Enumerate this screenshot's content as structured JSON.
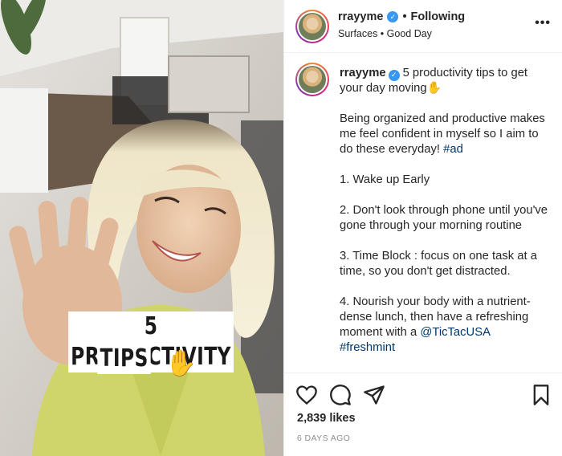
{
  "post": {
    "media_caption": {
      "line1": "5 PRODUCTIVITY",
      "line2": "TIPS",
      "emoji": "✋"
    }
  },
  "header": {
    "username": "rrayyme",
    "separator": "•",
    "follow_status": "Following",
    "location": "Surfaces • Good Day",
    "more_icon": "more-icon"
  },
  "caption": {
    "username": "rrayyme",
    "title": "5 productivity tips to get your day moving✋",
    "intro_text": "Being organized and productive makes me feel confident in myself so I aim to do these everyday! ",
    "intro_tag": "#ad",
    "tip1": "1. Wake up Early",
    "tip2": "2. Don't look through phone until you've gone through your morning routine",
    "tip3": "3. Time Block : focus on one task at a time, so you don't get distracted.",
    "tip4_text": "4. Nourish your body with a nutrient-dense lunch, then have a refreshing moment with a ",
    "tip4_mention": "@TicTacUSA",
    "tip4_tag": "#freshmint"
  },
  "actions": {
    "like_icon": "heart-icon",
    "comment_icon": "comment-icon",
    "share_icon": "paper-plane-icon",
    "save_icon": "bookmark-icon",
    "likes": "2,839 likes",
    "time_ago": "6 DAYS AGO"
  },
  "colors": {
    "verified": "#3897f0",
    "link": "#00376b",
    "muted": "#8e8e8e"
  }
}
